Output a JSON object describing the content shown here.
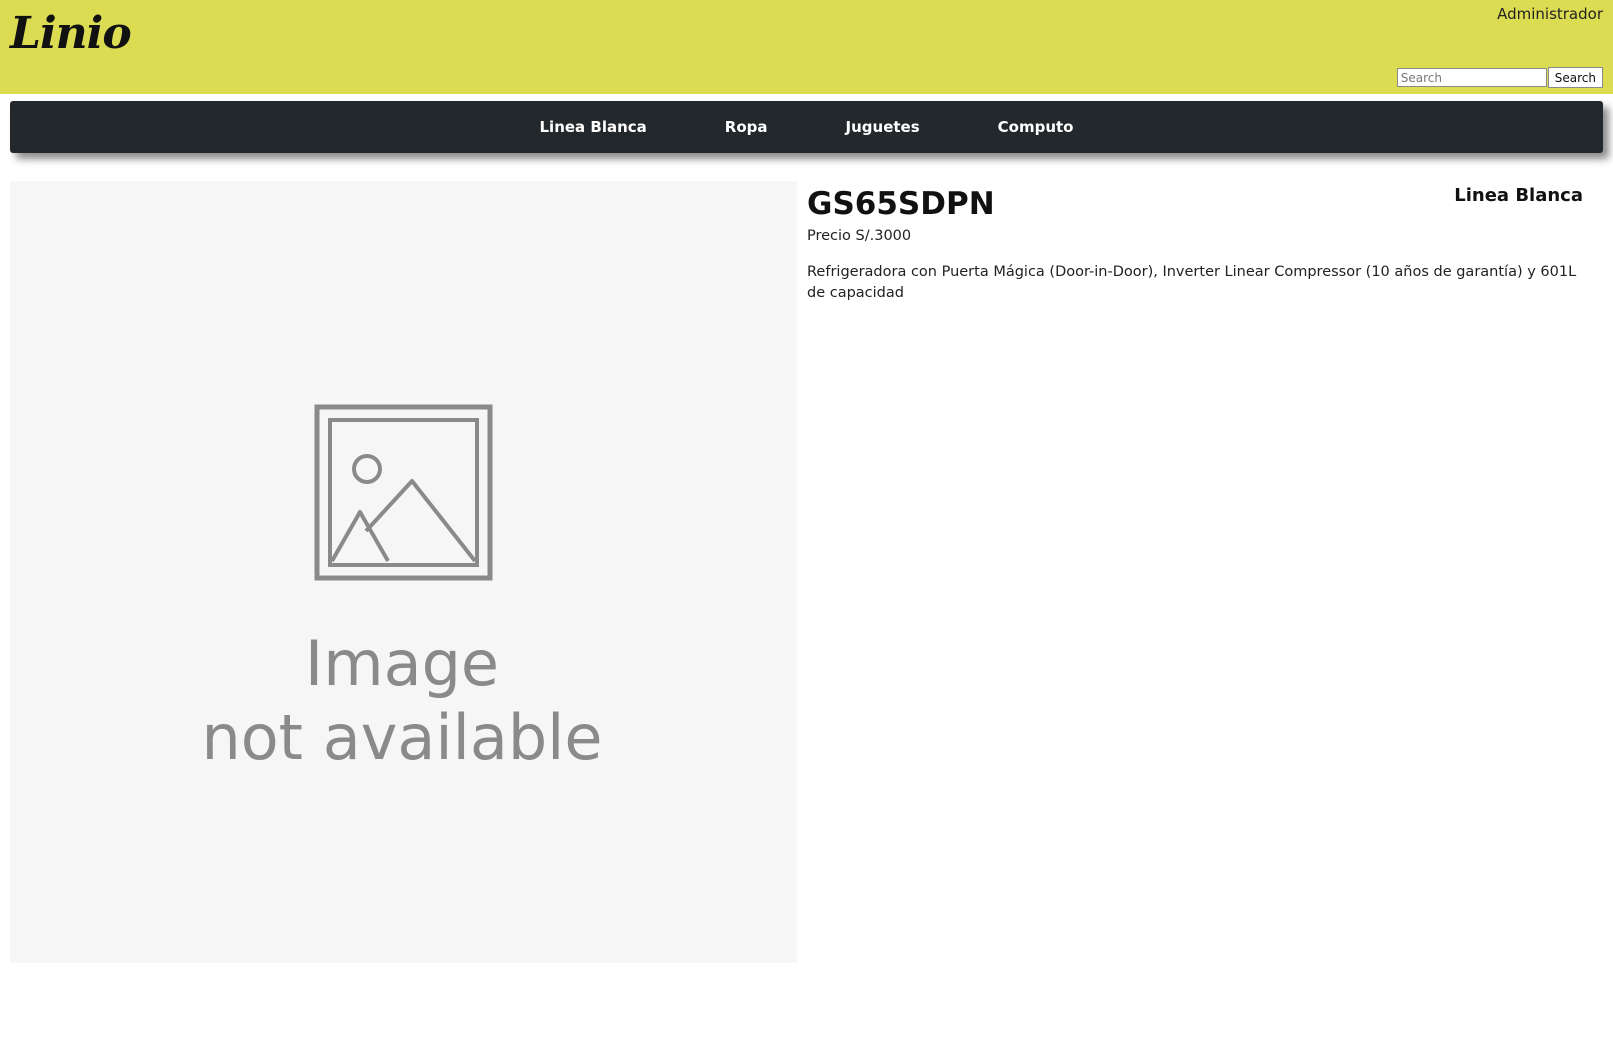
{
  "header": {
    "logo_text": "Linio",
    "user_label": "Administrador",
    "search": {
      "placeholder": "Search",
      "value": "",
      "button_label": "Search"
    },
    "background_color": "#dcdc52"
  },
  "nav": {
    "items": [
      {
        "label": "Linea Blanca"
      },
      {
        "label": "Ropa"
      },
      {
        "label": "Juguetes"
      },
      {
        "label": "Computo"
      }
    ],
    "background_color": "#23282d"
  },
  "product": {
    "image_placeholder": {
      "icon": "image-placeholder-icon",
      "line1": "Image",
      "line2": "not available"
    },
    "name": "GS65SDPN",
    "category": "Linea Blanca",
    "price": "Precio S/.3000",
    "description": "Refrigeradora con Puerta Mágica (Door-in-Door), Inverter Linear Compressor (10 años de garantía) y 601L de capacidad"
  }
}
